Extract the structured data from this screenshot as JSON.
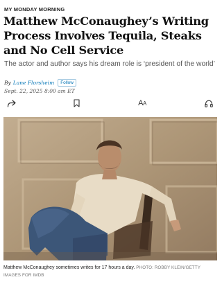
{
  "article": {
    "kicker": "MY MONDAY MORNING",
    "headline": "Matthew McConaughey’s Writing Process Involves Tequila, Steaks and No Cell Service",
    "dek": "The actor and author says his dream role is ‘president of the world’",
    "byline_prefix": "By",
    "author": "Lane Florsheim",
    "follow_label": "Follow",
    "date": "Sept. 22, 2025 8:00 am ET"
  },
  "toolbar": {
    "share_icon": "share-arrow-icon",
    "bookmark_icon": "bookmark-icon",
    "text_size_label_large": "A",
    "text_size_label_small": "A",
    "listen_icon": "headphones-icon"
  },
  "photo": {
    "caption": "Matthew McConaughey sometimes writes for 17 hours a day.",
    "credit": "PHOTO: ROBBY KLEIN/GETTY IMAGES FOR IMDB"
  },
  "colors": {
    "link": "#0274b6",
    "wall": "#b39c80",
    "shirt": "#e8dcc6",
    "jeans": "#3c5678"
  }
}
